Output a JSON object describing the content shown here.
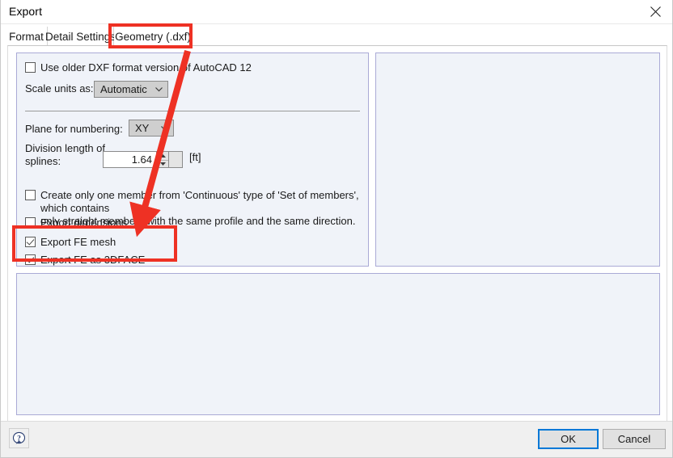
{
  "window": {
    "title": "Export",
    "close_icon": "close-icon"
  },
  "tabs": [
    {
      "id": "format",
      "label": "Format",
      "active": false
    },
    {
      "id": "detail",
      "label": "Detail Settings",
      "active": false
    },
    {
      "id": "geometry",
      "label": "Geometry (.dxf)",
      "active": true
    }
  ],
  "form": {
    "use_older_dxf": {
      "label": "Use older DXF format version of AutoCAD 12",
      "checked": false
    },
    "scale_units": {
      "label": "Scale units as:",
      "value": "Automatic",
      "chevron_icon": "chevron-down-icon"
    },
    "plane_numbering": {
      "label": "Plane for numbering:",
      "value": "XY",
      "chevron_icon": "chevron-down-icon"
    },
    "division_length": {
      "label_line1": "Division length of",
      "label_line2": "splines:",
      "value": "1.64",
      "unit": "[ft]",
      "spinner_up_icon": "spinner-up-icon",
      "spinner_down_icon": "spinner-down-icon"
    },
    "continuous_member": {
      "label_line1": "Create only one member from 'Continuous' type of 'Set of members', which contains",
      "label_line2": "only straight members with the same profile and the same direction.",
      "checked": false
    },
    "export_dimensions": {
      "label": "Export dimensions",
      "checked": false
    },
    "export_fe_mesh": {
      "label": "Export FE mesh",
      "checked": true
    },
    "export_fe_3dface": {
      "label": "Export FE as 3DFACE",
      "checked": true
    }
  },
  "footer": {
    "help_icon": "help-question-icon",
    "ok_label": "OK",
    "cancel_label": "Cancel"
  },
  "annotations": {
    "highlight_color": "#ee3124",
    "boxes": [
      {
        "name": "geometry-tab-highlight"
      },
      {
        "name": "export-fe-options-highlight"
      }
    ],
    "arrow": {
      "name": "pointer-arrow",
      "from": "AutoCAD 12 label",
      "to": "Export FE options"
    }
  },
  "colors": {
    "panel_bg": "#f0f3f9",
    "panel_border": "#aaaad6",
    "focus_blue": "#0078d7",
    "annotation_red": "#ee3124"
  }
}
